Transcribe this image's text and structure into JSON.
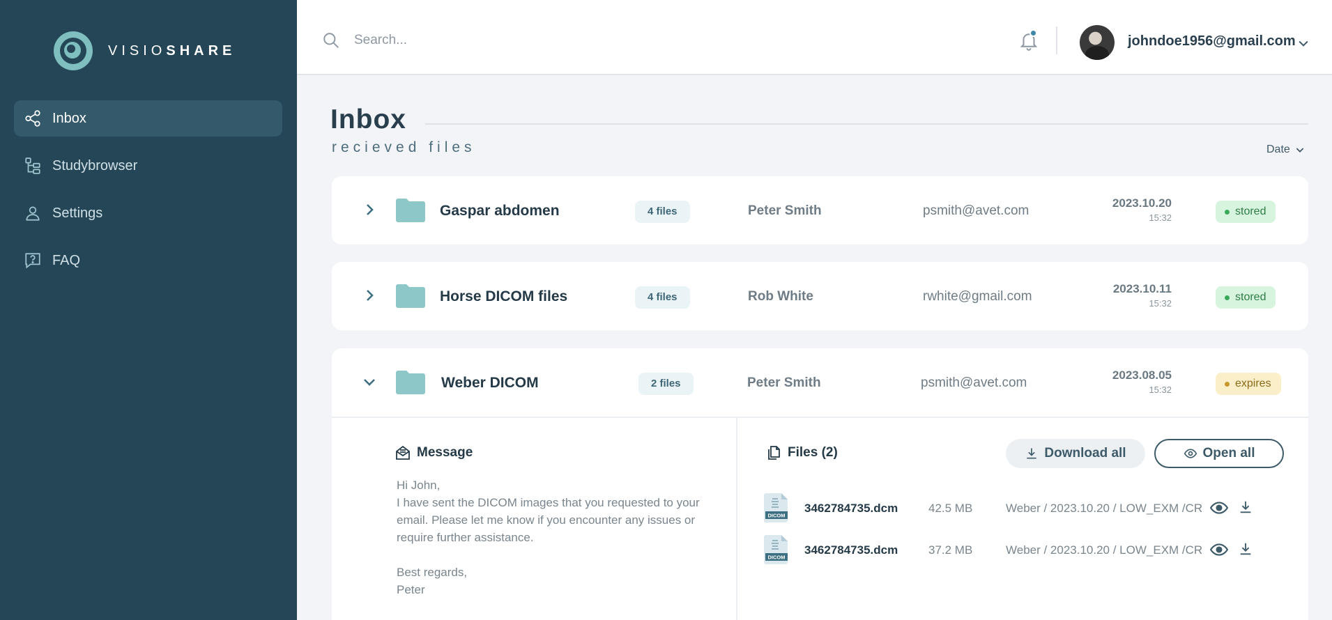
{
  "app": {
    "logo_light": "VISIO",
    "logo_bold": "SHARE"
  },
  "sidebar": {
    "items": [
      {
        "label": "Inbox",
        "icon": "share-icon",
        "active": true
      },
      {
        "label": "Studybrowser",
        "icon": "tree-icon",
        "active": false
      },
      {
        "label": "Settings",
        "icon": "user-icon",
        "active": false
      },
      {
        "label": "FAQ",
        "icon": "help-icon",
        "active": false
      }
    ]
  },
  "header": {
    "search_placeholder": "Search...",
    "user_email": "johndoe1956@gmail.com"
  },
  "main": {
    "title": "Inbox",
    "subtitle": "recieved files",
    "sort_label": "Date"
  },
  "rows": [
    {
      "name": "Gaspar abdomen",
      "files": "4 files",
      "sender": "Peter Smith",
      "email": "psmith@avet.com",
      "date": "2023.10.20",
      "time": "15:32",
      "status": "stored",
      "expanded": false
    },
    {
      "name": "Horse DICOM files",
      "files": "4 files",
      "sender": "Rob White",
      "email": "rwhite@gmail.com",
      "date": "2023.10.11",
      "time": "15:32",
      "status": "stored",
      "expanded": false
    },
    {
      "name": "Weber DICOM",
      "files": "2 files",
      "sender": "Peter Smith",
      "email": "psmith@avet.com",
      "date": "2023.08.05",
      "time": "15:32",
      "status": "expires",
      "expanded": true
    }
  ],
  "detail": {
    "message_title": "Message",
    "message_body": "Hi John,\nI have sent the DICOM images that you requested to your email.  Please let me know if you encounter any issues or require further assistance.\n\nBest regards,\nPeter",
    "files_title": "Files (2)",
    "download_all": "Download all",
    "open_all": "Open all",
    "files": [
      {
        "name": "3462784735.dcm",
        "size": "42.5 MB",
        "path": "Weber / 2023.10.20 / LOW_EXM /CR"
      },
      {
        "name": "3462784735.dcm",
        "size": "37.2 MB",
        "path": "Weber / 2023.10.20 / LOW_EXM /CR"
      }
    ],
    "icon_label": "DICOM"
  },
  "colors": {
    "sidebar": "#254657",
    "accent": "#7fbfbf",
    "stored": "#d7f5de",
    "expires": "#fbefc9"
  }
}
